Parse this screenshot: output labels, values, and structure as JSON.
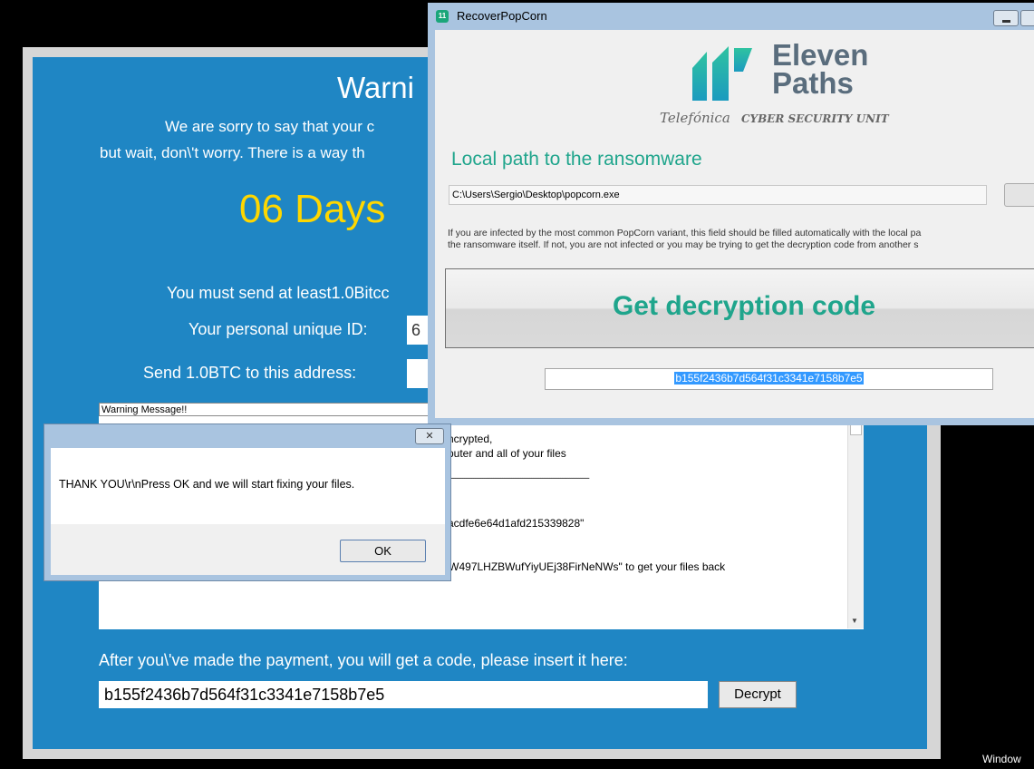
{
  "ransom_window": {
    "title": "Warni",
    "subtitle_1": "We are sorry to say that your c",
    "subtitle_2": "but wait, don\\'t worry. There is a way th",
    "timer": "06 Days",
    "send_text": "You must send at least1.0Bitcc",
    "id_label": "Your personal unique ID:",
    "id_value": "6",
    "address_label": "Send 1.0BTC to this address:",
    "message_title": "Warning Message!!",
    "message_lines": [
      "ncrypted,",
      "puter and all of your files",
      "------------------------------------------------------------------------------",
      "acdfe6e64d1afd215339828\"",
      "You must send at least \"1.0\" Bitcoin to address \"1Crx6HHW497LHZBWufYiyUEj38FirNeNWs\" to get your files back"
    ],
    "after_payment_text": "After you\\'ve made the payment, you will get a code, please insert it here:",
    "code_value": "b155f2436b7d564f31c3341e7158b7e5",
    "decrypt_button": "Decrypt"
  },
  "recover_window": {
    "title": "RecoverPopCorn",
    "logo_line1": "Eleven",
    "logo_line2": "Paths",
    "logo_telefonica": "Telefónica",
    "logo_unit": "CYBER SECURITY UNIT",
    "heading": "Local path to the ransomware",
    "path_value": "C:\\Users\\Sergio\\Desktop\\popcorn.exe",
    "info_line1": "If you are infected by the most common PopCorn variant, this field should be filled automatically with the local pa",
    "info_line2": "the ransomware itself. If not, you are not infected or you may be trying to get the decryption code from another s",
    "get_code_button": "Get decryption code",
    "code_value": "b155f2436b7d564f31c3341e7158b7e5"
  },
  "thank_you_dialog": {
    "message": "THANK YOU\\r\\nPress OK and we will start fixing your files.",
    "ok_button": "OK",
    "close_glyph": "✕"
  },
  "taskbar": {
    "text": "Window"
  },
  "colors": {
    "ransom_blue": "#1f86c4",
    "timer_yellow": "#ffd700",
    "elevenpaths_teal": "#1fa58c",
    "selection_blue": "#3399ff"
  }
}
